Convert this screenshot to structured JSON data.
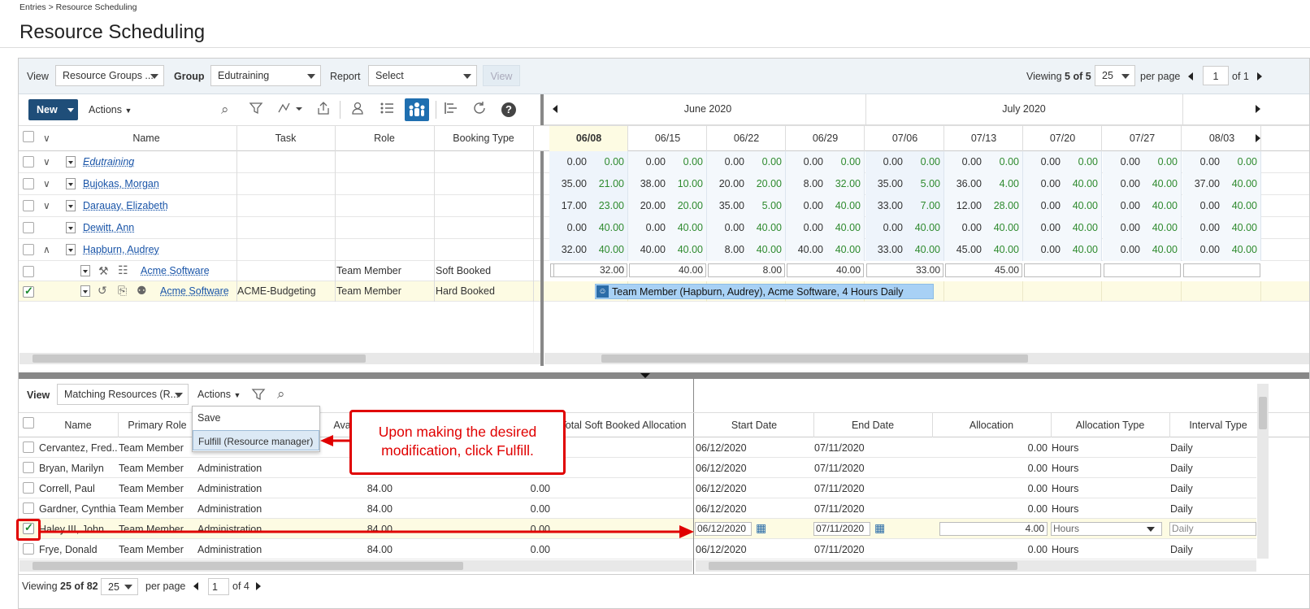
{
  "breadcrumb": "Entries > Resource Scheduling",
  "page_title": "Resource Scheduling",
  "filters": {
    "view_label": "View",
    "view_value": "Resource Groups ...",
    "group_label": "Group",
    "group_value": "Edutraining",
    "report_label": "Report",
    "report_value": "Select",
    "view_button": "View",
    "viewing_prefix": "Viewing",
    "viewing_count": "5 of 5",
    "per_page_value": "25",
    "per_page_label": "per page",
    "page_value": "1",
    "page_of": "of 1"
  },
  "toolbar": {
    "new_label": "New",
    "actions_label": "Actions"
  },
  "grid": {
    "columns": [
      "Name",
      "Task",
      "Role",
      "Booking Type"
    ],
    "rows": [
      {
        "name": "Edutraining"
      },
      {
        "name": "Bujokas, Morgan"
      },
      {
        "name": "Darauay, Elizabeth"
      },
      {
        "name": "Dewitt, Ann"
      },
      {
        "name": "Hapburn, Audrey"
      },
      {
        "name": "Acme Software",
        "task": "",
        "role": "Team Member",
        "booking": "Soft Booked"
      },
      {
        "name": "Acme Software",
        "task": "ACME-Budgeting",
        "role": "Team Member",
        "booking": "Hard Booked"
      }
    ]
  },
  "timeline": {
    "months": [
      "June 2020",
      "July 2020"
    ],
    "weeks": [
      "06/08",
      "06/15",
      "06/22",
      "06/29",
      "07/06",
      "07/13",
      "07/20",
      "07/27",
      "08/03"
    ],
    "rows": [
      [
        [
          "0.00",
          "0.00"
        ],
        [
          "0.00",
          "0.00"
        ],
        [
          "0.00",
          "0.00"
        ],
        [
          "0.00",
          "0.00"
        ],
        [
          "0.00",
          "0.00"
        ],
        [
          "0.00",
          "0.00"
        ],
        [
          "0.00",
          "0.00"
        ],
        [
          "0.00",
          "0.00"
        ],
        [
          "0.00",
          "0.00"
        ]
      ],
      [
        [
          "35.00",
          "21.00"
        ],
        [
          "38.00",
          "10.00"
        ],
        [
          "20.00",
          "20.00"
        ],
        [
          "8.00",
          "32.00"
        ],
        [
          "35.00",
          "5.00"
        ],
        [
          "36.00",
          "4.00"
        ],
        [
          "0.00",
          "40.00"
        ],
        [
          "0.00",
          "40.00"
        ],
        [
          "37.00",
          "40.00"
        ]
      ],
      [
        [
          "17.00",
          "23.00"
        ],
        [
          "20.00",
          "20.00"
        ],
        [
          "35.00",
          "5.00"
        ],
        [
          "0.00",
          "40.00"
        ],
        [
          "33.00",
          "7.00"
        ],
        [
          "12.00",
          "28.00"
        ],
        [
          "0.00",
          "40.00"
        ],
        [
          "0.00",
          "40.00"
        ],
        [
          "0.00",
          "40.00"
        ]
      ],
      [
        [
          "0.00",
          "40.00"
        ],
        [
          "0.00",
          "40.00"
        ],
        [
          "0.00",
          "40.00"
        ],
        [
          "0.00",
          "40.00"
        ],
        [
          "0.00",
          "40.00"
        ],
        [
          "0.00",
          "40.00"
        ],
        [
          "0.00",
          "40.00"
        ],
        [
          "0.00",
          "40.00"
        ],
        [
          "0.00",
          "40.00"
        ]
      ],
      [
        [
          "32.00",
          "40.00"
        ],
        [
          "40.00",
          "40.00"
        ],
        [
          "8.00",
          "40.00"
        ],
        [
          "40.00",
          "40.00"
        ],
        [
          "33.00",
          "40.00"
        ],
        [
          "45.00",
          "40.00"
        ],
        [
          "0.00",
          "40.00"
        ],
        [
          "0.00",
          "40.00"
        ],
        [
          "0.00",
          "40.00"
        ]
      ]
    ],
    "input_row": [
      "32.00",
      "40.00",
      "8.00",
      "40.00",
      "33.00",
      "45.00",
      "",
      "",
      ""
    ],
    "booking_bar": "Team Member (Hapburn, Audrey), Acme Software, 4 Hours Daily"
  },
  "lower": {
    "view_label": "View",
    "view_value": "Matching Resources (R...",
    "actions_label": "Actions",
    "menu": [
      "Save",
      "Fulfill (Resource manager)"
    ],
    "columns_left": [
      "Name",
      "Primary Role",
      "Ava",
      "Total Soft Booked Allocation"
    ],
    "columns_right": [
      "Start Date",
      "End Date",
      "Allocation",
      "Allocation Type",
      "Interval Type"
    ],
    "rows": [
      {
        "name": "Cervantez, Fred...",
        "role": "Team Member",
        "dept": "",
        "avail": "",
        "soft": "",
        "start": "06/12/2020",
        "end": "07/11/2020",
        "alloc": "0.00",
        "type": "Hours",
        "interval": "Daily"
      },
      {
        "name": "Bryan, Marilyn",
        "role": "Team Member",
        "dept": "Administration",
        "avail": "",
        "soft": "",
        "start": "06/12/2020",
        "end": "07/11/2020",
        "alloc": "0.00",
        "type": "Hours",
        "interval": "Daily"
      },
      {
        "name": "Correll, Paul",
        "role": "Team Member",
        "dept": "Administration",
        "avail": "84.00",
        "soft": "0.00",
        "start": "06/12/2020",
        "end": "07/11/2020",
        "alloc": "0.00",
        "type": "Hours",
        "interval": "Daily"
      },
      {
        "name": "Gardner, Cynthia",
        "role": "Team Member",
        "dept": "Administration",
        "avail": "84.00",
        "soft": "0.00",
        "start": "06/12/2020",
        "end": "07/11/2020",
        "alloc": "0.00",
        "type": "Hours",
        "interval": "Daily"
      },
      {
        "name": "Haley III, John",
        "role": "Team Member",
        "dept": "Administration",
        "avail": "84.00",
        "soft": "0.00",
        "start": "06/12/2020",
        "end": "07/11/2020",
        "alloc": "4.00",
        "type": "Hours",
        "interval": "Daily"
      },
      {
        "name": "Frye, Donald",
        "role": "Team Member",
        "dept": "Administration",
        "avail": "84.00",
        "soft": "0.00",
        "start": "06/12/2020",
        "end": "07/11/2020",
        "alloc": "0.00",
        "type": "Hours",
        "interval": "Daily"
      }
    ],
    "footer": {
      "viewing_prefix": "Viewing",
      "viewing_count": "25 of 82",
      "per_page_value": "25",
      "per_page_label": "per page",
      "page_value": "1",
      "page_of": "of 4"
    }
  },
  "callout": "Upon making the desired modification, click Fulfill.",
  "colors": {
    "accent": "#1f4e79",
    "highlight": "#e00000",
    "positive": "#2e8a2e",
    "bar": "#a8d1f5"
  }
}
